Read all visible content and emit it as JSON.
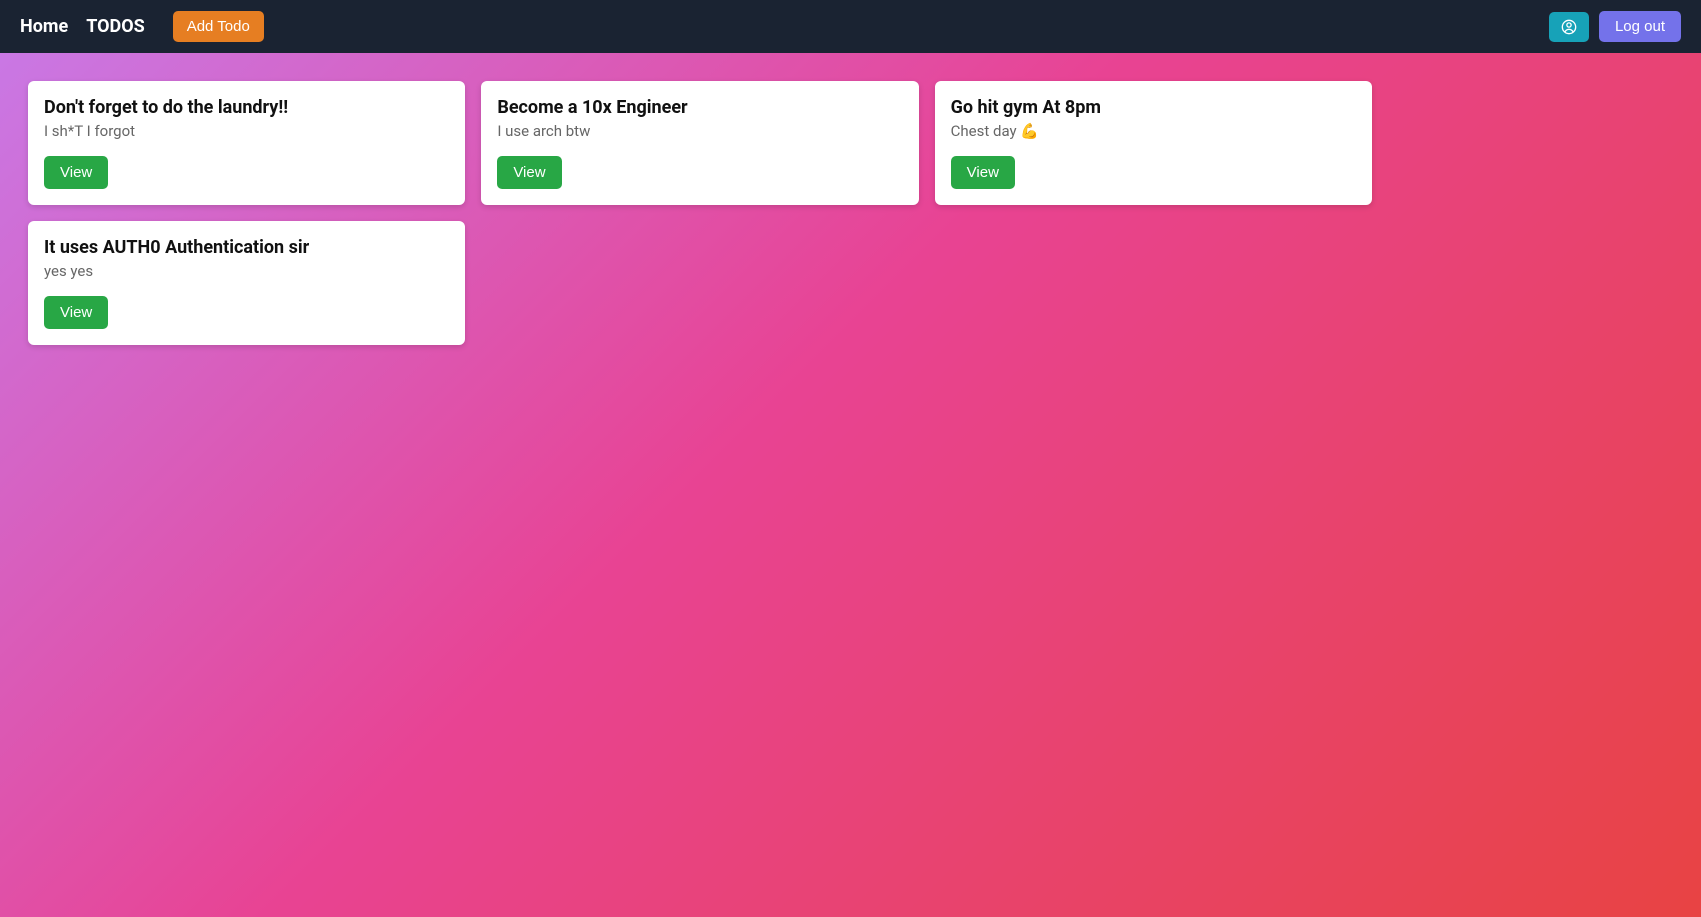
{
  "nav": {
    "home": "Home",
    "todos": "TODOS",
    "add_todo": "Add Todo",
    "logout": "Log out"
  },
  "todos": [
    {
      "title": "Don't forget to do the laundry!!",
      "subtitle": "I sh*T I forgot",
      "view_label": "View"
    },
    {
      "title": "Become a 10x Engineer",
      "subtitle": "I use arch btw",
      "view_label": "View"
    },
    {
      "title": "Go hit gym At 8pm",
      "subtitle": "Chest day 💪",
      "view_label": "View"
    },
    {
      "title": "It uses AUTH0 Authentication sir",
      "subtitle": "yes yes",
      "view_label": "View"
    }
  ]
}
